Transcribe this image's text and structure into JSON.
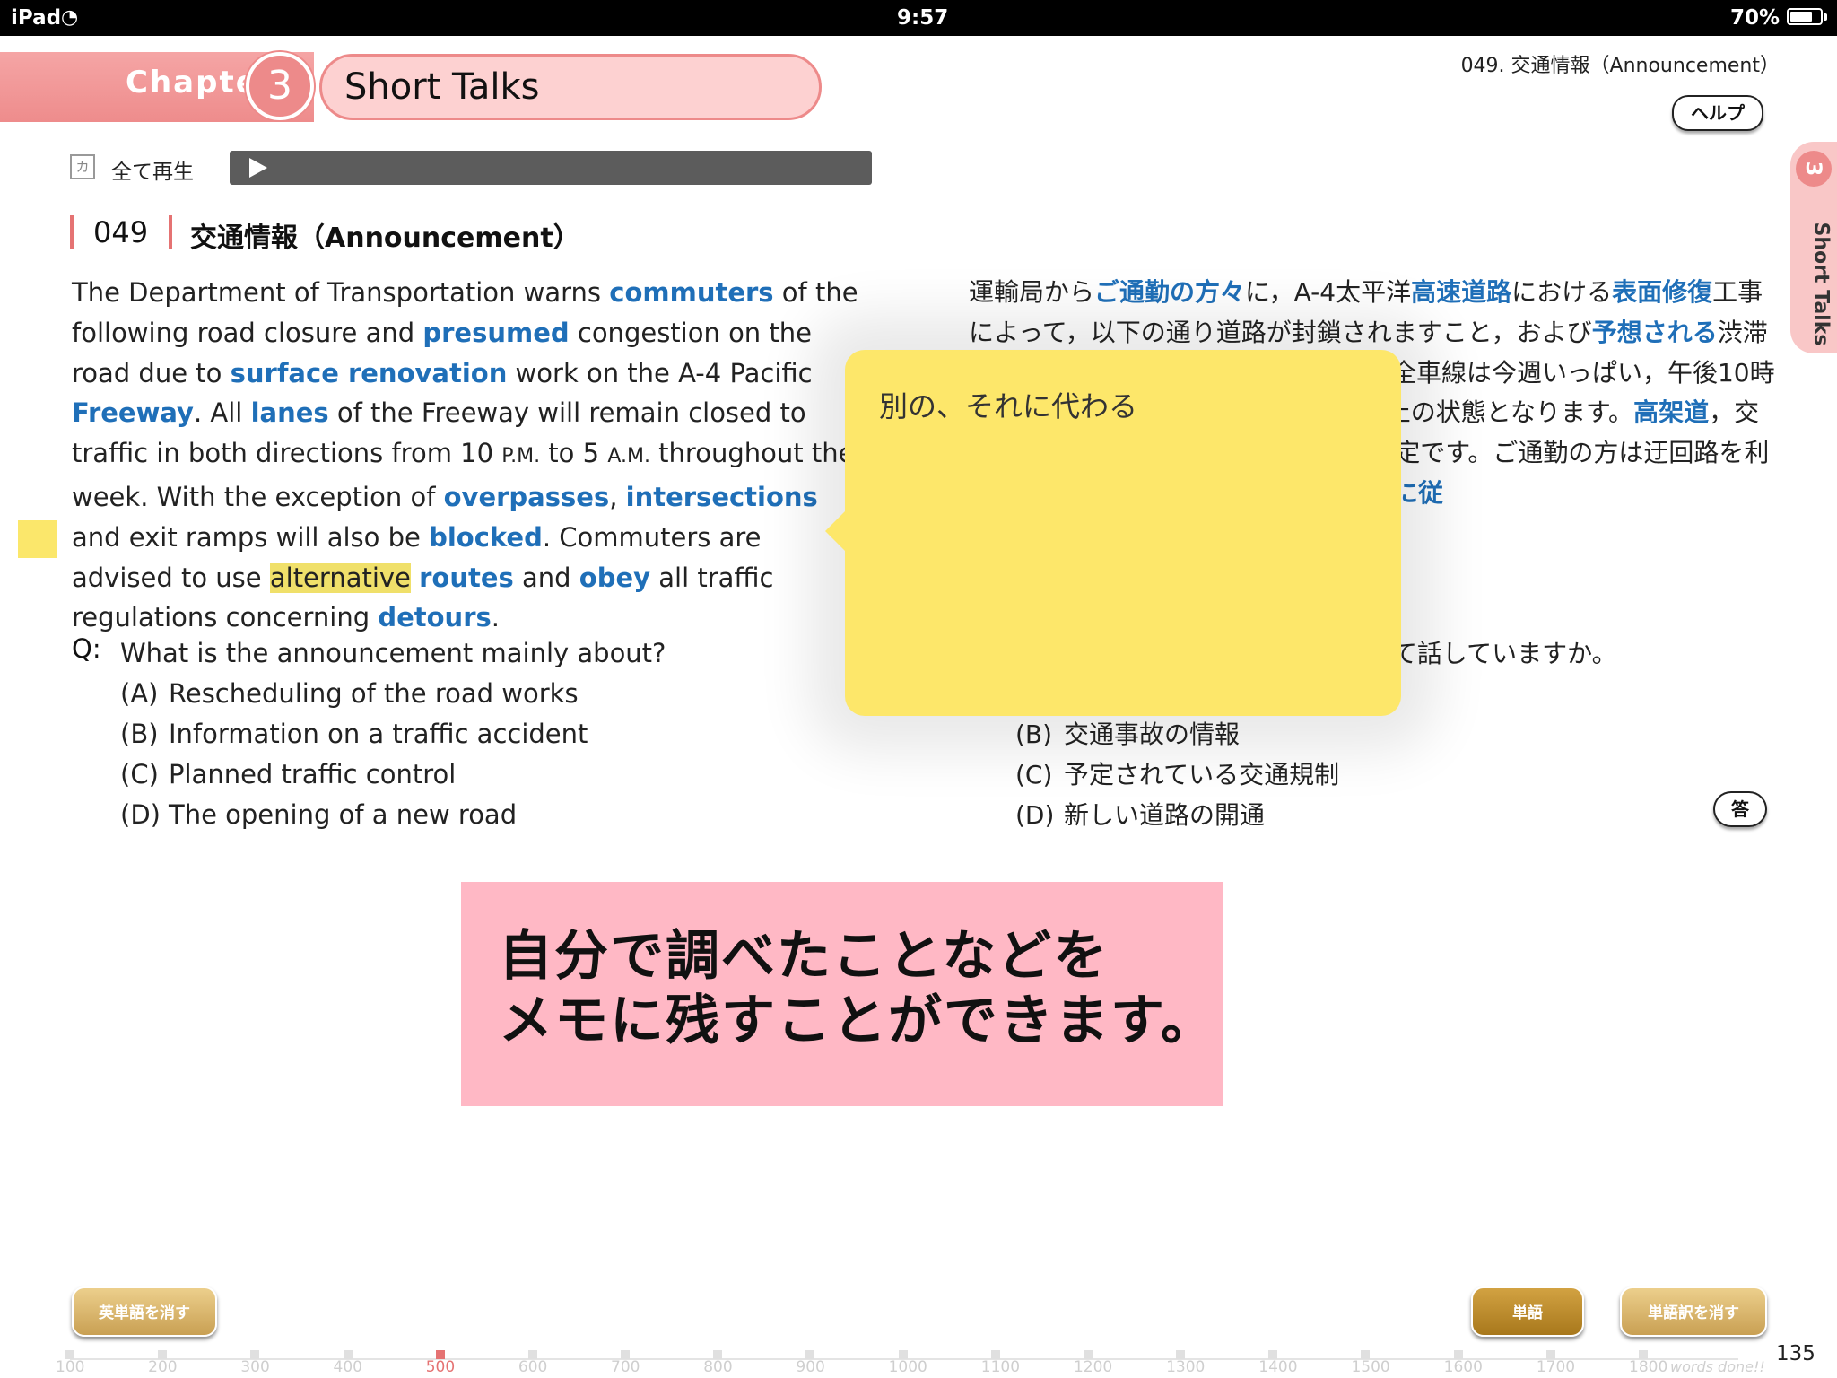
{
  "status_bar": {
    "device": "iPad",
    "time": "9:57",
    "battery": "70%",
    "battery_level": 0.7
  },
  "header": {
    "chapter_word": "Chapter",
    "chapter_number": "3",
    "chapter_title": "Short Talks",
    "section_label": "049. 交通情報（Announcement）",
    "help_label": "ヘルプ"
  },
  "side_tab": {
    "number": "3",
    "label": "Short Talks"
  },
  "player": {
    "kana_icon": "カ",
    "play_all_label": "全て再生",
    "play_icon": "play-icon"
  },
  "passage": {
    "number": "049",
    "title": "交通情報（Announcement）",
    "en": [
      {
        "t": "The Department of Transportation warns "
      },
      {
        "t": "commuters",
        "k": 1
      },
      {
        "t": " of the following road closure and "
      },
      {
        "t": "presumed",
        "k": 1
      },
      {
        "t": " congestion on the road due to "
      },
      {
        "t": "surface renovation",
        "k": 1
      },
      {
        "t": " work on the A-4 Pacific "
      },
      {
        "t": "Freeway",
        "k": 1
      },
      {
        "t": ". All "
      },
      {
        "t": "lanes",
        "k": 1
      },
      {
        "t": " of the Freeway will remain closed to traffic in both directions from 10 "
      },
      {
        "t": "P.M.",
        "s": 1
      },
      {
        "t": " to 5 "
      },
      {
        "t": "A.M.",
        "s": 1
      },
      {
        "t": " throughout the week.  With the exception of "
      },
      {
        "t": "overpasses",
        "k": 1
      },
      {
        "t": ", "
      },
      {
        "t": "intersections",
        "k": 1
      },
      {
        "t": " and exit ramps will also be "
      },
      {
        "t": "blocked",
        "k": 1
      },
      {
        "t": ".  Commuters are advised to use "
      },
      {
        "t": "alternative",
        "h": 1
      },
      {
        "t": " "
      },
      {
        "t": "routes",
        "k": 1
      },
      {
        "t": " and "
      },
      {
        "t": "obey",
        "k": 1
      },
      {
        "t": " all traffic regulations concerning "
      },
      {
        "t": "detours",
        "k": 1
      },
      {
        "t": "."
      }
    ],
    "jp": [
      {
        "t": "運輸局から"
      },
      {
        "t": "ご通勤の方々",
        "k": 1
      },
      {
        "t": "に，A-4太平洋"
      },
      {
        "t": "高速道路",
        "k": 1
      },
      {
        "t": "における"
      },
      {
        "t": "表面修復",
        "k": 1
      },
      {
        "t": "工事によって，以下の通り道路が封鎖されますこと，および"
      },
      {
        "t": "予想される",
        "k": 1
      },
      {
        "t": "渋滞についてお知らせします。高速道路の全車線は今週いっぱい，午後10時から午前5時まで，上下線とも通行禁止の状態となります。"
      },
      {
        "t": "高架道",
        "k": 1
      },
      {
        "t": "，交差点および出口ランプも"
      },
      {
        "t": "閉鎖さ",
        "k": 1
      },
      {
        "t": "れる予定です。ご通勤の方は迂回路を利用し，迂回に関するすべての交通規則"
      },
      {
        "t": "に従",
        "k": 1
      }
    ]
  },
  "question": {
    "label": "Q:",
    "text": "What is the announcement mainly about?",
    "options": [
      {
        "letter": "(A)",
        "text": "Rescheduling of the road works"
      },
      {
        "letter": "(B)",
        "text": "Information on a traffic accident"
      },
      {
        "letter": "(C)",
        "text": "Planned traffic control"
      },
      {
        "letter": "(D)",
        "text": "The opening of a new road"
      }
    ],
    "jp_text": "て話していますか。",
    "jp_options": [
      {
        "letter": "(B)",
        "text": "交通事故の情報"
      },
      {
        "letter": "(C)",
        "text": "予定されている交通規制"
      },
      {
        "letter": "(D)",
        "text": "新しい道路の開通"
      }
    ],
    "answer_label": "答"
  },
  "memo": {
    "text": "別の、それに代わる",
    "color": "#fde76a"
  },
  "caption": {
    "line1": "自分で調べたことなどを",
    "line2": "メモに残すことができます。"
  },
  "bottom": {
    "hide_english_label": "英単語を消す",
    "word_label": "単語",
    "hide_translation_label": "単語訳を消す",
    "progress_ticks": [
      "100",
      "200",
      "300",
      "400",
      "500",
      "600",
      "700",
      "800",
      "900",
      "1000",
      "1100",
      "1200",
      "1300",
      "1400",
      "1500",
      "1600",
      "1700",
      "1800"
    ],
    "current_tick": "500",
    "words_done_label": "words done!!",
    "page_number": "135"
  },
  "colors": {
    "accent_pink": "#ed8a8a",
    "keyword_blue": "#1f6fb8",
    "gold": "#c9a053"
  }
}
